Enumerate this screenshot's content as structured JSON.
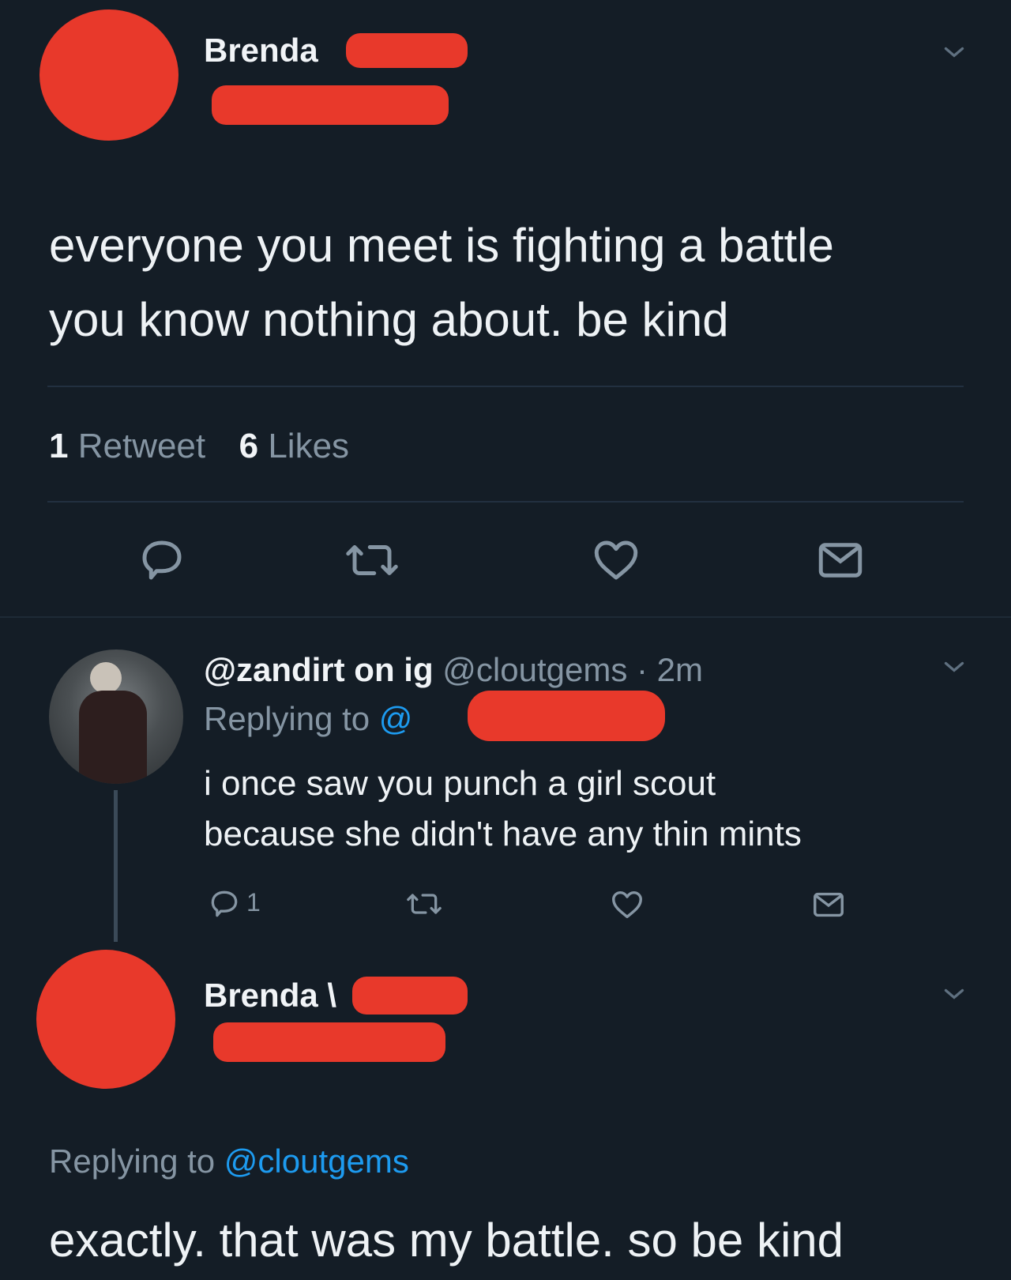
{
  "main_tweet": {
    "author_name": "Brenda",
    "text_line1": "everyone you meet is fighting a battle",
    "text_line2": "you know nothing about. be kind",
    "retweet_count": "1",
    "retweet_label": "Retweet",
    "like_count": "6",
    "like_label": "Likes"
  },
  "reply_tweet": {
    "author_name": "@zandirt on ig",
    "handle": "@cloutgems",
    "time": "· 2m",
    "replying_to_prefix": "Replying to",
    "replying_to_handle": "@",
    "text_line1": "i once saw you punch a girl scout",
    "text_line2": "because she didn't have any thin mints",
    "reply_count": "1"
  },
  "final_tweet": {
    "author_name": "Brenda",
    "name_suffix": "\\",
    "replying_to_prefix": "Replying to",
    "replying_to_handle": "@cloutgems",
    "text": "exactly. that was my battle. so be kind"
  },
  "icons": [
    "reply-icon",
    "retweet-icon",
    "like-icon",
    "dm-icon",
    "chevron-down-icon"
  ],
  "colors": {
    "background": "#141d26",
    "redaction": "#e8392b",
    "link": "#1d9bf0",
    "muted": "#8595a3"
  }
}
